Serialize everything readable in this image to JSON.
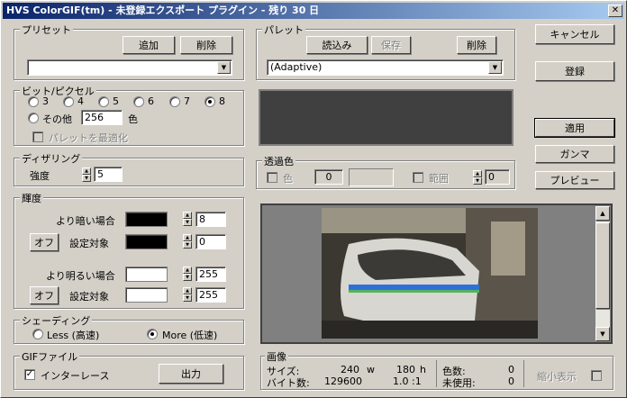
{
  "window": {
    "title": "HVS ColorGIF(tm) - 未登録エクスポート プラグイン - 残り 30 日",
    "close": "✕"
  },
  "preset": {
    "label": "プリセット",
    "add": "追加",
    "delete": "削除",
    "value": ""
  },
  "palette": {
    "label": "パレット",
    "load": "読込み",
    "save": "保存",
    "delete": "削除",
    "value": "(Adaptive)"
  },
  "buttons": {
    "cancel": "キャンセル",
    "register": "登録",
    "apply": "適用",
    "gamma": "ガンマ",
    "preview": "プレビュー"
  },
  "bits": {
    "label": "ビット/ピクセル",
    "options": [
      "3",
      "4",
      "5",
      "6",
      "7",
      "8"
    ],
    "selected": "8",
    "other_label": "その他",
    "other_value": "256",
    "color_unit": "色",
    "optimize": "パレットを最適化"
  },
  "dither": {
    "label": "ディザリング",
    "strength_label": "強度",
    "strength_value": "5"
  },
  "transparency": {
    "label": "透過色",
    "color_label": "色",
    "color_value": "0",
    "range_label": "範囲",
    "range_value": "0"
  },
  "brightness": {
    "label": "輝度",
    "darker_label": "より暗い場合",
    "darker_value": "8",
    "off1": "オフ",
    "target1": "設定対象",
    "target1_value": "0",
    "brighter_label": "より明るい場合",
    "brighter_value": "255",
    "off2": "オフ",
    "target2": "設定対象",
    "target2_value": "255"
  },
  "shading": {
    "label": "シェーディング",
    "less": "Less (高速)",
    "more": "More (低速)",
    "selected": "more"
  },
  "gif": {
    "label": "GIFファイル",
    "interlace": "インターレース",
    "interlace_checked": true,
    "output": "出力"
  },
  "image": {
    "label": "画像",
    "size_label": "サイズ:",
    "width": "240",
    "w_unit": "w",
    "height": "180",
    "h_unit": "h",
    "bytes_label": "バイト数:",
    "bytes": "129600",
    "ratio": "1.0 :1",
    "colors_label": "色数:",
    "colors": "0",
    "unused_label": "未使用:",
    "unused": "0",
    "shrink_label": "縮小表示"
  },
  "colors": {
    "titlebar_start": "#0a246a",
    "titlebar_end": "#a6caf0",
    "face": "#d4d0c8",
    "darker_swatch": "#000000",
    "target1_swatch": "#000000",
    "brighter_swatch": "#ffffff",
    "target2_swatch": "#ffffff",
    "palette_preview": "#404040",
    "preview_bg": "#808080"
  }
}
